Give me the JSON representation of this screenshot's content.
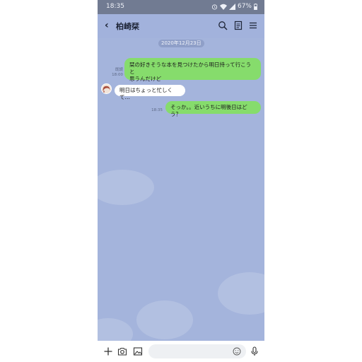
{
  "status_bar": {
    "time": "18:35",
    "battery": "67%"
  },
  "header": {
    "title": "柏崎栞"
  },
  "chat": {
    "date": "2020年12月23日",
    "messages": [
      {
        "direction": "out",
        "line1": "栞の好きそうな本を見つけたから明日持って行こうと",
        "line2": "思うんだけど",
        "read": "既読",
        "time": "18:00"
      },
      {
        "direction": "in",
        "text": "明日はちょっと忙しくて…"
      },
      {
        "direction": "out",
        "text": "そっか。。近いうちに明後日はどう？",
        "time": "18:35"
      }
    ]
  },
  "input": {
    "placeholder": ""
  },
  "icons": {
    "header": [
      "back-icon",
      "search-icon",
      "notes-icon",
      "menu-icon"
    ],
    "status": [
      "alarm-icon",
      "wifi-icon",
      "signal-icon",
      "battery-icon"
    ],
    "bottom": [
      "plus-icon",
      "camera-icon",
      "image-icon",
      "emoji-icon",
      "mic-icon"
    ]
  },
  "colors": {
    "background": "#a4b4dc",
    "header": "#a2b2dc",
    "status_bar": "#717b92",
    "bubble_out": "#86dc6c",
    "bubble_in": "#ffffff"
  }
}
